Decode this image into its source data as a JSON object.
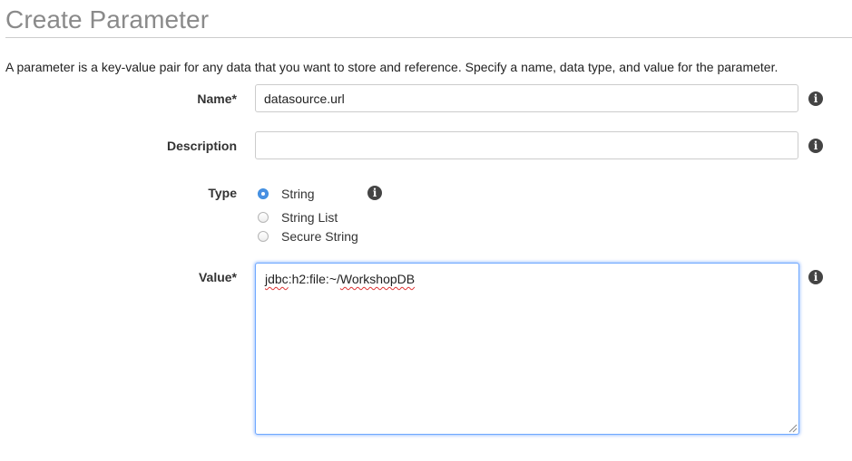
{
  "page": {
    "title": "Create Parameter",
    "intro": "A parameter is a key-value pair for any data that you want to store and reference. Specify a name, data type, and value for the parameter."
  },
  "form": {
    "name": {
      "label": "Name*",
      "value": "datasource.url",
      "info_icon": "info-icon"
    },
    "description": {
      "label": "Description",
      "value": "",
      "info_icon": "info-icon"
    },
    "type": {
      "label": "Type",
      "info_icon": "info-icon",
      "options": [
        {
          "label": "String",
          "selected": true
        },
        {
          "label": "String List",
          "selected": false
        },
        {
          "label": "Secure String",
          "selected": false
        }
      ]
    },
    "value": {
      "label": "Value*",
      "text_parts": [
        "jdbc",
        ":h2:file:~/",
        "WorkshopDB"
      ],
      "info_icon": "info-icon"
    }
  },
  "colors": {
    "title": "#8a8a8a",
    "radio_selected": "#4a90e2",
    "focus_border": "#6fa8ff",
    "info_icon_bg": "#444444"
  }
}
